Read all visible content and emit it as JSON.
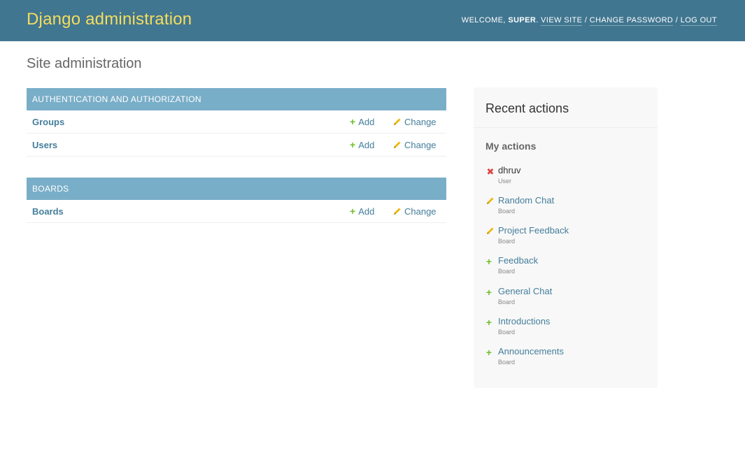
{
  "header": {
    "branding": "Django administration",
    "welcome": "WELCOME,",
    "username": "SUPER",
    "links": {
      "view_site": "VIEW SITE",
      "change_password": "CHANGE PASSWORD",
      "log_out": "LOG OUT"
    },
    "separator": "/",
    "colors": {
      "background": "#417690",
      "branding": "#f5dd5d"
    }
  },
  "page_title": "Site administration",
  "apps": [
    {
      "caption": "AUTHENTICATION AND AUTHORIZATION",
      "models": [
        {
          "name": "Groups",
          "add": "Add",
          "change": "Change"
        },
        {
          "name": "Users",
          "add": "Add",
          "change": "Change"
        }
      ]
    },
    {
      "caption": "BOARDS",
      "models": [
        {
          "name": "Boards",
          "add": "Add",
          "change": "Change"
        }
      ]
    }
  ],
  "recent_actions": {
    "title": "Recent actions",
    "subtitle": "My actions",
    "items": [
      {
        "icon": "delete-icon",
        "name": "dhruv",
        "type": "User"
      },
      {
        "icon": "pencil-icon",
        "name": "Random Chat",
        "type": "Board"
      },
      {
        "icon": "pencil-icon",
        "name": "Project Feedback",
        "type": "Board"
      },
      {
        "icon": "plus-icon",
        "name": "Feedback",
        "type": "Board"
      },
      {
        "icon": "plus-icon",
        "name": "General Chat",
        "type": "Board"
      },
      {
        "icon": "plus-icon",
        "name": "Introductions",
        "type": "Board"
      },
      {
        "icon": "plus-icon",
        "name": "Announcements",
        "type": "Board"
      }
    ]
  },
  "colors": {
    "module_caption": "#79aec8",
    "link": "#447e9b",
    "add_icon": "#70bf2b",
    "change_icon": "#efb80b",
    "delete_icon": "#dd4646"
  }
}
